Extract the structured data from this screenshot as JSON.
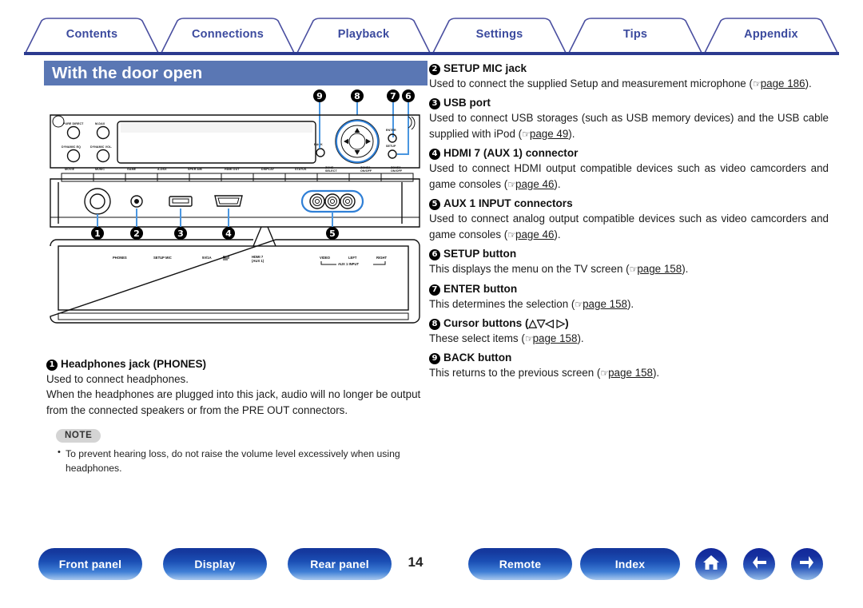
{
  "header": {
    "tabs": [
      {
        "label": "Contents"
      },
      {
        "label": "Connections"
      },
      {
        "label": "Playback"
      },
      {
        "label": "Settings"
      },
      {
        "label": "Tips"
      },
      {
        "label": "Appendix"
      }
    ],
    "accent_color": "#2b3a8f",
    "tab_text_color": "#3b4a9e"
  },
  "section": {
    "title": "With the door open",
    "title_bg": "#5a77b4",
    "title_color": "#ffffff"
  },
  "figure": {
    "name": "front-panel-with-door-open-diagram",
    "knob_labels": [
      "PURE DIRECT",
      "M-DAX",
      "DYNAMIC EQ",
      "DYNAMIC VOL."
    ],
    "button_labels": [
      "MOVIE",
      "MUSIC",
      "GAME",
      "A-DSX",
      "SPKR A/B",
      "HDMI OUT",
      "DISPLAY",
      "STATUS",
      "ZONE SELECT",
      "ZONE2 ON/OFF",
      "ZONE3 ON/OFF"
    ],
    "cursor_area_labels": [
      "BACK",
      "ENTER",
      "SETUP"
    ],
    "jack_labels": [
      "PHONES",
      "SETUP MIC",
      "5V/1A",
      "HDMI 7",
      "(AUX 1)",
      "VIDEO",
      "LEFT",
      "RIGHT",
      "AUX 1 INPUT"
    ],
    "callouts_top": [
      "9",
      "8",
      "7",
      "6"
    ],
    "callouts_bottom": [
      "1",
      "2",
      "3",
      "4",
      "5"
    ]
  },
  "left_items": [
    {
      "num": "1",
      "title": "Headphones jack (PHONES)",
      "lines": [
        "Used to connect headphones.",
        "When the headphones are plugged into this jack, audio will no longer be output from the connected speakers or from the PRE OUT connectors."
      ]
    }
  ],
  "note": {
    "badge": "NOTE",
    "items": [
      "To prevent hearing loss, do not raise the volume level excessively when using headphones."
    ]
  },
  "right_items": [
    {
      "num": "2",
      "title": "SETUP MIC jack",
      "body_before": "Used to connect the supplied Setup and measurement microphone (",
      "link": "page 186",
      "body_after": ")."
    },
    {
      "num": "3",
      "title": "USB port",
      "body_before": "Used to connect USB storages (such as USB memory devices) and the USB cable supplied with iPod (",
      "link": "page 49",
      "body_after": ")."
    },
    {
      "num": "4",
      "title": "HDMI 7 (AUX 1) connector",
      "body_before": "Used to connect HDMI output compatible devices such as video camcorders  and game consoles (",
      "link": "page 46",
      "body_after": ")."
    },
    {
      "num": "5",
      "title": "AUX 1 INPUT connectors",
      "body_before": "Used to connect analog output compatible devices such as video camcorders  and game consoles (",
      "link": "page 46",
      "body_after": ")."
    },
    {
      "num": "6",
      "title": "SETUP button",
      "body_before": "This displays the menu on the TV screen (",
      "link": "page 158",
      "body_after": ")."
    },
    {
      "num": "7",
      "title": "ENTER button",
      "body_before": "This determines the selection (",
      "link": "page 158",
      "body_after": ")."
    },
    {
      "num": "8",
      "title": "Cursor buttons (△▽◁ ▷)",
      "body_before": "These select items (",
      "link": "page 158",
      "body_after": ")."
    },
    {
      "num": "9",
      "title": "BACK button",
      "body_before": "This returns to the previous screen (",
      "link": "page 158",
      "body_after": ")."
    }
  ],
  "footer": {
    "page_number": "14",
    "buttons": [
      {
        "label": "Front panel"
      },
      {
        "label": "Display"
      },
      {
        "label": "Rear panel"
      },
      {
        "label": "Remote"
      },
      {
        "label": "Index"
      }
    ],
    "icons": [
      {
        "name": "home-icon"
      },
      {
        "name": "arrow-left-icon"
      },
      {
        "name": "arrow-right-icon"
      }
    ],
    "button_color": "#15399e"
  }
}
